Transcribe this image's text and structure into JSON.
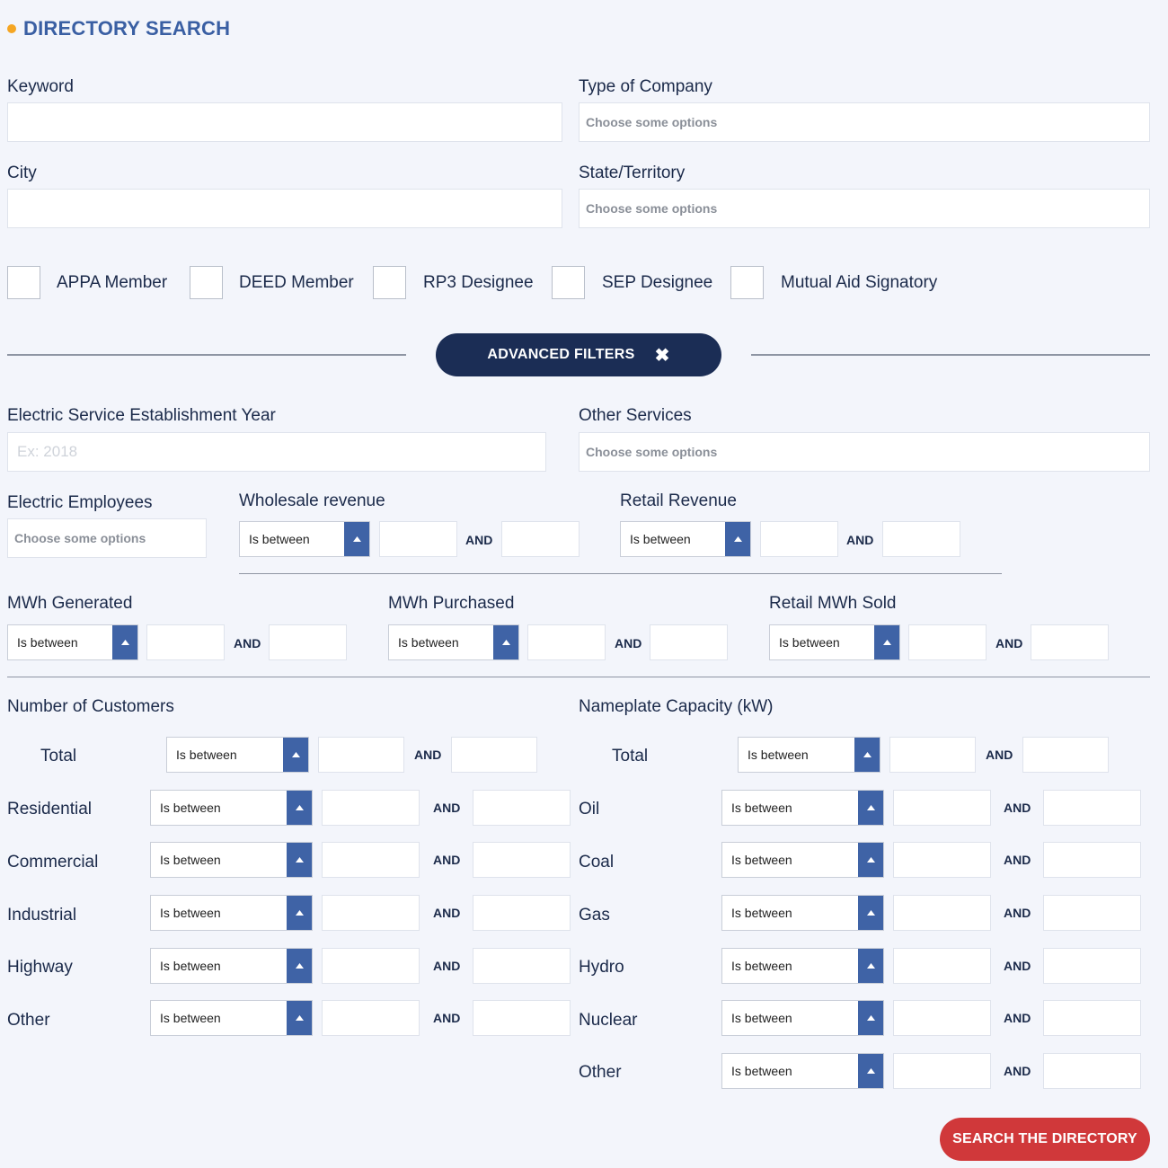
{
  "title": "DIRECTORY SEARCH",
  "keyword": {
    "label": "Keyword",
    "value": ""
  },
  "type_of_company": {
    "label": "Type of Company",
    "placeholder": "Choose some options"
  },
  "city": {
    "label": "City",
    "value": ""
  },
  "state": {
    "label": "State/Territory",
    "placeholder": "Choose some options"
  },
  "checkboxes": [
    {
      "label": "APPA Member",
      "checked": false
    },
    {
      "label": "DEED Member",
      "checked": false
    },
    {
      "label": "RP3 Designee",
      "checked": false
    },
    {
      "label": "SEP Designee",
      "checked": false
    },
    {
      "label": "Mutual Aid Signatory",
      "checked": false
    }
  ],
  "advanced_filters": {
    "label": "ADVANCED FILTERS",
    "close_icon": "close-icon"
  },
  "establishment_year": {
    "label": "Electric Service Establishment Year",
    "placeholder": "Ex: 2018"
  },
  "other_services": {
    "label": "Other Services",
    "placeholder": "Choose some options"
  },
  "electric_employees": {
    "label": "Electric Employees",
    "placeholder": "Choose some options"
  },
  "range_select_value": "Is between",
  "and_label": "AND",
  "wholesale_revenue": {
    "label": "Wholesale revenue"
  },
  "retail_revenue": {
    "label": "Retail Revenue"
  },
  "mwh_generated": {
    "label": "MWh Generated"
  },
  "mwh_purchased": {
    "label": "MWh Purchased"
  },
  "retail_mwh_sold": {
    "label": "Retail MWh Sold"
  },
  "customers": {
    "label": "Number of Customers",
    "rows": [
      "Total",
      "Residential",
      "Commercial",
      "Industrial",
      "Highway",
      "Other"
    ]
  },
  "capacity": {
    "label": "Nameplate Capacity (kW)",
    "rows": [
      "Total",
      "Oil",
      "Coal",
      "Gas",
      "Hydro",
      "Nuclear",
      "Other"
    ]
  },
  "search_button": "SEARCH THE DIRECTORY",
  "colors": {
    "accent": "#3a5fa3",
    "dark_button": "#1b2d55",
    "search_button": "#d0383a",
    "dot": "#f5a623"
  }
}
